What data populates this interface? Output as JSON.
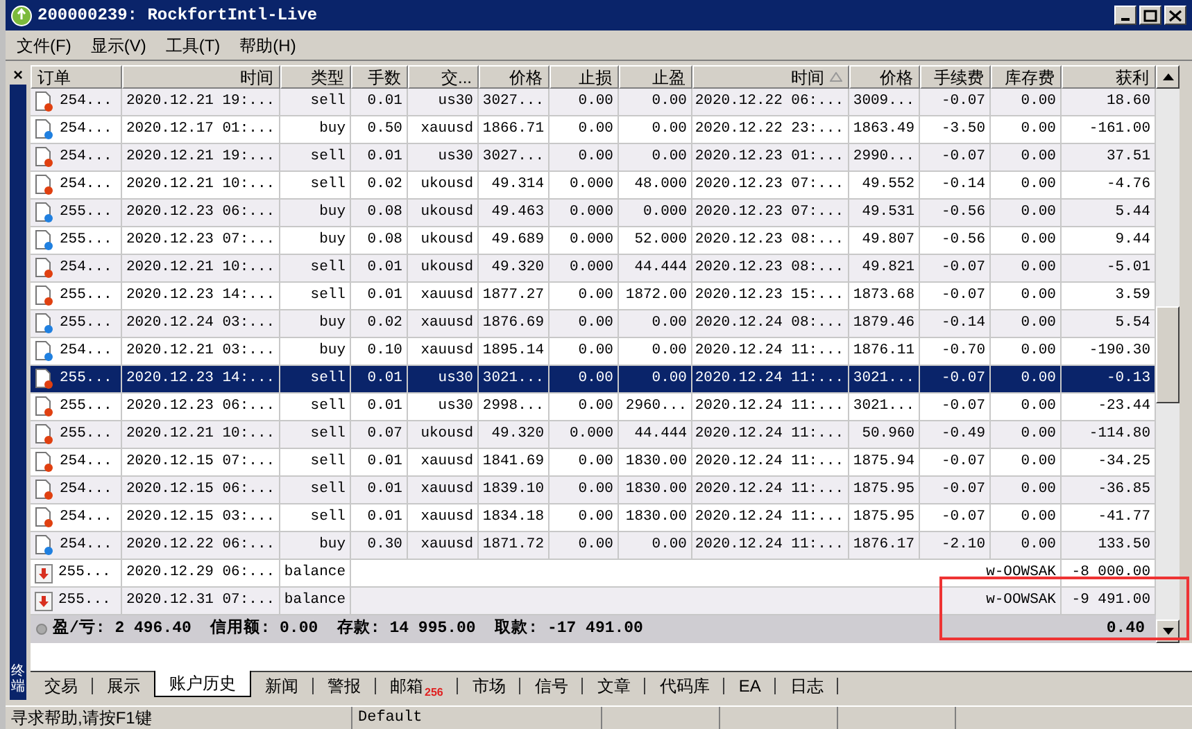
{
  "window": {
    "title": "200000239: RockfortIntl-Live"
  },
  "menu": [
    "文件(F)",
    "显示(V)",
    "工具(T)",
    "帮助(H)"
  ],
  "close_panel": "×",
  "side_label": "终端",
  "table": {
    "columns": [
      {
        "label": "订单",
        "sorted": false
      },
      {
        "label": "时间",
        "sorted": false
      },
      {
        "label": "类型",
        "sorted": false
      },
      {
        "label": "手数",
        "sorted": false
      },
      {
        "label": "交...",
        "sorted": false
      },
      {
        "label": "价格",
        "sorted": false
      },
      {
        "label": "止损",
        "sorted": false
      },
      {
        "label": "止盈",
        "sorted": false
      },
      {
        "label": "时间",
        "sorted": true
      },
      {
        "label": "价格",
        "sorted": false
      },
      {
        "label": "手续费",
        "sorted": false
      },
      {
        "label": "库存费",
        "sorted": false
      },
      {
        "label": "获利",
        "sorted": false
      }
    ],
    "rows": [
      {
        "kind": "sell",
        "selected": false,
        "cells": [
          "254...",
          "2020.12.21 19:...",
          "sell",
          "0.01",
          "us30",
          "3027...",
          "0.00",
          "0.00",
          "2020.12.22 06:...",
          "3009...",
          "-0.07",
          "0.00",
          "18.60"
        ]
      },
      {
        "kind": "buy",
        "selected": false,
        "cells": [
          "254...",
          "2020.12.17 01:...",
          "buy",
          "0.50",
          "xauusd",
          "1866.71",
          "0.00",
          "0.00",
          "2020.12.22 23:...",
          "1863.49",
          "-3.50",
          "0.00",
          "-161.00"
        ]
      },
      {
        "kind": "sell",
        "selected": false,
        "cells": [
          "254...",
          "2020.12.21 19:...",
          "sell",
          "0.01",
          "us30",
          "3027...",
          "0.00",
          "0.00",
          "2020.12.23 01:...",
          "2990...",
          "-0.07",
          "0.00",
          "37.51"
        ]
      },
      {
        "kind": "sell",
        "selected": false,
        "cells": [
          "254...",
          "2020.12.21 10:...",
          "sell",
          "0.02",
          "ukousd",
          "49.314",
          "0.000",
          "48.000",
          "2020.12.23 07:...",
          "49.552",
          "-0.14",
          "0.00",
          "-4.76"
        ]
      },
      {
        "kind": "buy",
        "selected": false,
        "cells": [
          "255...",
          "2020.12.23 06:...",
          "buy",
          "0.08",
          "ukousd",
          "49.463",
          "0.000",
          "0.000",
          "2020.12.23 07:...",
          "49.531",
          "-0.56",
          "0.00",
          "5.44"
        ]
      },
      {
        "kind": "buy",
        "selected": false,
        "cells": [
          "255...",
          "2020.12.23 07:...",
          "buy",
          "0.08",
          "ukousd",
          "49.689",
          "0.000",
          "52.000",
          "2020.12.23 08:...",
          "49.807",
          "-0.56",
          "0.00",
          "9.44"
        ]
      },
      {
        "kind": "sell",
        "selected": false,
        "cells": [
          "254...",
          "2020.12.21 10:...",
          "sell",
          "0.01",
          "ukousd",
          "49.320",
          "0.000",
          "44.444",
          "2020.12.23 08:...",
          "49.821",
          "-0.07",
          "0.00",
          "-5.01"
        ]
      },
      {
        "kind": "sell",
        "selected": false,
        "cells": [
          "255...",
          "2020.12.23 14:...",
          "sell",
          "0.01",
          "xauusd",
          "1877.27",
          "0.00",
          "1872.00",
          "2020.12.23 15:...",
          "1873.68",
          "-0.07",
          "0.00",
          "3.59"
        ]
      },
      {
        "kind": "buy",
        "selected": false,
        "cells": [
          "255...",
          "2020.12.24 03:...",
          "buy",
          "0.02",
          "xauusd",
          "1876.69",
          "0.00",
          "0.00",
          "2020.12.24 08:...",
          "1879.46",
          "-0.14",
          "0.00",
          "5.54"
        ]
      },
      {
        "kind": "buy",
        "selected": false,
        "cells": [
          "254...",
          "2020.12.21 03:...",
          "buy",
          "0.10",
          "xauusd",
          "1895.14",
          "0.00",
          "0.00",
          "2020.12.24 11:...",
          "1876.11",
          "-0.70",
          "0.00",
          "-190.30"
        ]
      },
      {
        "kind": "sell",
        "selected": true,
        "cells": [
          "255...",
          "2020.12.23 14:...",
          "sell",
          "0.01",
          "us30",
          "3021...",
          "0.00",
          "0.00",
          "2020.12.24 11:...",
          "3021...",
          "-0.07",
          "0.00",
          "-0.13"
        ]
      },
      {
        "kind": "sell",
        "selected": false,
        "cells": [
          "255...",
          "2020.12.23 06:...",
          "sell",
          "0.01",
          "us30",
          "2998...",
          "0.00",
          "2960...",
          "2020.12.24 11:...",
          "3021...",
          "-0.07",
          "0.00",
          "-23.44"
        ]
      },
      {
        "kind": "sell",
        "selected": false,
        "cells": [
          "255...",
          "2020.12.21 10:...",
          "sell",
          "0.07",
          "ukousd",
          "49.320",
          "0.000",
          "44.444",
          "2020.12.24 11:...",
          "50.960",
          "-0.49",
          "0.00",
          "-114.80"
        ]
      },
      {
        "kind": "sell",
        "selected": false,
        "cells": [
          "254...",
          "2020.12.15 07:...",
          "sell",
          "0.01",
          "xauusd",
          "1841.69",
          "0.00",
          "1830.00",
          "2020.12.24 11:...",
          "1875.94",
          "-0.07",
          "0.00",
          "-34.25"
        ]
      },
      {
        "kind": "sell",
        "selected": false,
        "cells": [
          "254...",
          "2020.12.15 06:...",
          "sell",
          "0.01",
          "xauusd",
          "1839.10",
          "0.00",
          "1830.00",
          "2020.12.24 11:...",
          "1875.95",
          "-0.07",
          "0.00",
          "-36.85"
        ]
      },
      {
        "kind": "sell",
        "selected": false,
        "cells": [
          "254...",
          "2020.12.15 03:...",
          "sell",
          "0.01",
          "xauusd",
          "1834.18",
          "0.00",
          "1830.00",
          "2020.12.24 11:...",
          "1875.95",
          "-0.07",
          "0.00",
          "-41.77"
        ]
      },
      {
        "kind": "buy",
        "selected": false,
        "cells": [
          "254...",
          "2020.12.22 06:...",
          "buy",
          "0.30",
          "xauusd",
          "1871.72",
          "0.00",
          "0.00",
          "2020.12.24 11:...",
          "1876.17",
          "-2.10",
          "0.00",
          "133.50"
        ]
      },
      {
        "kind": "balance",
        "selected": false,
        "cells": [
          "255...",
          "2020.12.29 06:...",
          "balance",
          "w-OOWSAK",
          "-8 000.00"
        ]
      },
      {
        "kind": "balance",
        "selected": false,
        "cells": [
          "255...",
          "2020.12.31 07:...",
          "balance",
          "w-OOWSAK",
          "-9 491.00"
        ]
      }
    ],
    "summary": {
      "text": "盈/亏: 2 496.40  信用额: 0.00  存款: 14 995.00  取款: -17 491.00",
      "total": "0.40"
    }
  },
  "tabs": [
    {
      "label": "交易",
      "selected": false
    },
    {
      "label": "展示",
      "selected": false
    },
    {
      "label": "账户历史",
      "selected": true
    },
    {
      "label": "新闻",
      "selected": false
    },
    {
      "label": "警报",
      "selected": false
    },
    {
      "label": "邮箱",
      "selected": false,
      "badge": "256"
    },
    {
      "label": "市场",
      "selected": false
    },
    {
      "label": "信号",
      "selected": false
    },
    {
      "label": "文章",
      "selected": false
    },
    {
      "label": "代码库",
      "selected": false
    },
    {
      "label": "EA",
      "selected": false
    },
    {
      "label": "日志",
      "selected": false
    }
  ],
  "status_bar": [
    "寻求帮助,请按F1键",
    "Default"
  ]
}
